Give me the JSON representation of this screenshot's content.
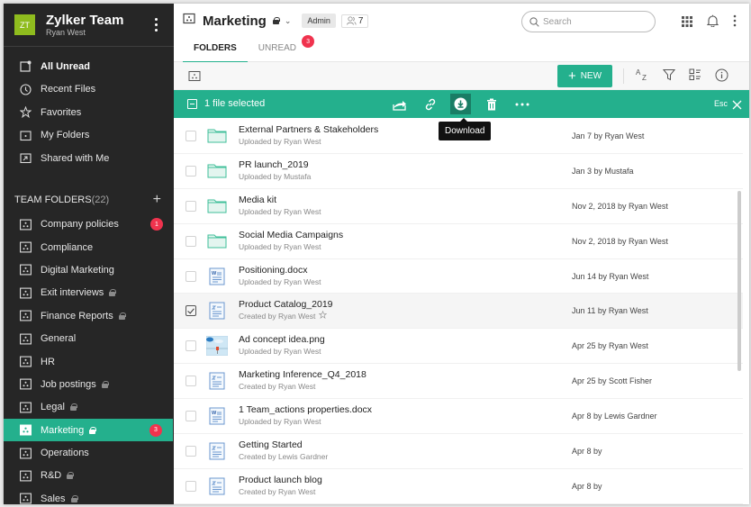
{
  "sidebar": {
    "avatar_initials": "ZT",
    "team_name": "Zylker Team",
    "user_name": "Ryan West",
    "nav": [
      {
        "label": "All Unread",
        "icon": "unread-icon"
      },
      {
        "label": "Recent Files",
        "icon": "clock-icon"
      },
      {
        "label": "Favorites",
        "icon": "star-icon"
      },
      {
        "label": "My Folders",
        "icon": "folder-icon"
      },
      {
        "label": "Shared with Me",
        "icon": "shared-folder-icon"
      }
    ],
    "team_folders_label": "TEAM FOLDERS",
    "team_folders_count": "(22)",
    "team_folders": [
      {
        "label": "Company policies",
        "locked": false,
        "badge": "1"
      },
      {
        "label": "Compliance",
        "locked": false,
        "badge": ""
      },
      {
        "label": "Digital Marketing",
        "locked": false,
        "badge": ""
      },
      {
        "label": "Exit interviews",
        "locked": true,
        "badge": ""
      },
      {
        "label": "Finance Reports",
        "locked": true,
        "badge": ""
      },
      {
        "label": "General",
        "locked": false,
        "badge": ""
      },
      {
        "label": "HR",
        "locked": false,
        "badge": ""
      },
      {
        "label": "Job postings",
        "locked": true,
        "badge": ""
      },
      {
        "label": "Legal",
        "locked": true,
        "badge": ""
      },
      {
        "label": "Marketing",
        "locked": true,
        "badge": "3",
        "active": true
      },
      {
        "label": "Operations",
        "locked": false,
        "badge": ""
      },
      {
        "label": "R&D",
        "locked": true,
        "badge": ""
      },
      {
        "label": "Sales",
        "locked": true,
        "badge": ""
      }
    ]
  },
  "header": {
    "title": "Marketing",
    "role": "Admin",
    "member_count": "7",
    "tabs": [
      {
        "label": "FOLDERS",
        "active": true
      },
      {
        "label": "UNREAD",
        "badge": "3"
      }
    ],
    "search_placeholder": "Search"
  },
  "toolbar": {
    "new_label": "NEW"
  },
  "selection": {
    "text": "1 file selected",
    "tooltip": "Download",
    "esc_label": "Esc"
  },
  "files": [
    {
      "name": "External Partners & Stakeholders",
      "sub": "Uploaded by Ryan West",
      "date": "Jan 7 by Ryan West",
      "type": "folder"
    },
    {
      "name": "PR launch_2019",
      "sub": "Uploaded by Mustafa",
      "date": "Jan 3 by Mustafa",
      "type": "folder"
    },
    {
      "name": "Media kit",
      "sub": "Uploaded by Ryan West",
      "date": "Nov 2, 2018 by Ryan West",
      "type": "folder"
    },
    {
      "name": "Social Media Campaigns",
      "sub": "Uploaded by Ryan West",
      "date": "Nov 2, 2018 by Ryan West",
      "type": "folder"
    },
    {
      "name": "Positioning.docx",
      "sub": "Uploaded by Ryan West",
      "date": "Jun 14 by Ryan West",
      "type": "docx"
    },
    {
      "name": "Product Catalog_2019",
      "sub": "Created by Ryan West",
      "date": "Jun 11 by Ryan West",
      "type": "writer",
      "selected": true,
      "star": true
    },
    {
      "name": "Ad concept idea.png",
      "sub": "Uploaded by Ryan West",
      "date": "Apr 25 by Ryan West",
      "type": "image"
    },
    {
      "name": "Marketing Inference_Q4_2018",
      "sub": "Created by Ryan West",
      "date": "Apr 25 by Scott Fisher",
      "type": "writer"
    },
    {
      "name": "1 Team_actions properties.docx",
      "sub": "Uploaded by Ryan West",
      "date": "Apr 8 by Lewis Gardner",
      "type": "docx"
    },
    {
      "name": "Getting Started",
      "sub": "Created by Lewis Gardner",
      "date": "Apr 8 by",
      "type": "writer"
    },
    {
      "name": "Product launch blog",
      "sub": "Created by Ryan West",
      "date": "Apr 8 by",
      "type": "writer"
    }
  ]
}
